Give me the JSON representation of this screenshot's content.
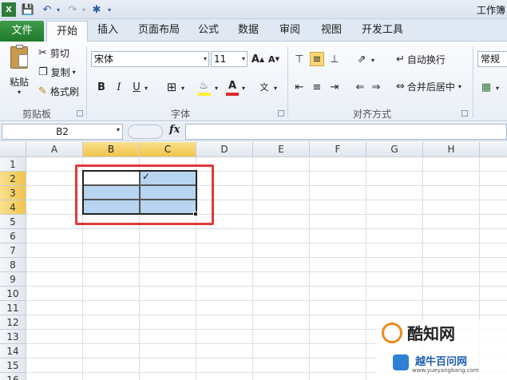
{
  "window": {
    "title": "工作簿"
  },
  "tabs": [
    {
      "label": "文件"
    },
    {
      "label": "开始"
    },
    {
      "label": "插入"
    },
    {
      "label": "页面布局"
    },
    {
      "label": "公式"
    },
    {
      "label": "数据"
    },
    {
      "label": "审阅"
    },
    {
      "label": "视图"
    },
    {
      "label": "开发工具"
    }
  ],
  "clipboard": {
    "paste": "粘贴",
    "cut": "剪切",
    "copy": "复制",
    "format_painter": "格式刷",
    "group": "剪贴板"
  },
  "font": {
    "name": "宋体",
    "size": "11",
    "bold": "B",
    "italic": "I",
    "underline": "U",
    "group": "字体"
  },
  "alignment": {
    "wrap_text": "自动换行",
    "merge_center": "合并后居中",
    "group": "对齐方式"
  },
  "number": {
    "format": "常规"
  },
  "formula_bar": {
    "name_box": "B2",
    "fx": "fx",
    "value": ""
  },
  "sheet": {
    "columns": [
      "A",
      "B",
      "C",
      "D",
      "E",
      "F",
      "G",
      "H"
    ],
    "selected_columns": [
      "B",
      "C"
    ],
    "rows": [
      "1",
      "2",
      "3",
      "4",
      "5",
      "6",
      "7",
      "8",
      "9",
      "10",
      "11",
      "12",
      "13",
      "14",
      "15",
      "16"
    ],
    "selected_rows": [
      "2",
      "3",
      "4"
    ],
    "cell_mark": "✓"
  },
  "watermark": {
    "line1": "酷知网",
    "line2": "越牛百问网",
    "url": "www.yueyangbang.com"
  },
  "colors": {
    "file_tab": "#2a8a37",
    "selection": "#b7d4f0",
    "highlight": "#e03a3a",
    "header_selected": "#f1c44a"
  }
}
